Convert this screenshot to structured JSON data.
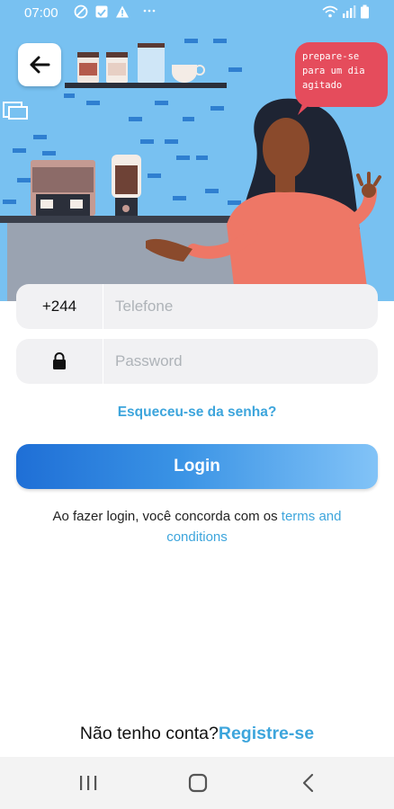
{
  "status_bar": {
    "time": "07:00",
    "icons": [
      "do-not-disturb-icon",
      "gallery-icon",
      "alert-icon",
      "more-dots-icon",
      "wifi-icon",
      "signal-icon",
      "battery-icon"
    ]
  },
  "hero": {
    "back_icon": "arrow-left-icon",
    "speech_bubble": "prepare-se para um dia agitado"
  },
  "form": {
    "country_code": "+244",
    "phone_placeholder": "Telefone",
    "password_placeholder": "Password",
    "lock_icon": "lock-icon"
  },
  "forgot_password": "Esqueceu-se da senha?",
  "login_button": "Login",
  "terms": {
    "prefix": "Ao fazer login, você concorda com os",
    "link": "terms and conditions"
  },
  "signup": {
    "question": "Não tenho conta?",
    "link": "Registre-se"
  },
  "nav": {
    "icons": [
      "recent-apps-icon",
      "home-icon",
      "back-icon"
    ]
  },
  "colors": {
    "sky": "#78c1f1",
    "accent": "#3da5dc",
    "button_start": "#1f6fd6",
    "button_end": "#82c3f7",
    "bubble": "#e54c5c",
    "shirt": "#ee7766"
  }
}
